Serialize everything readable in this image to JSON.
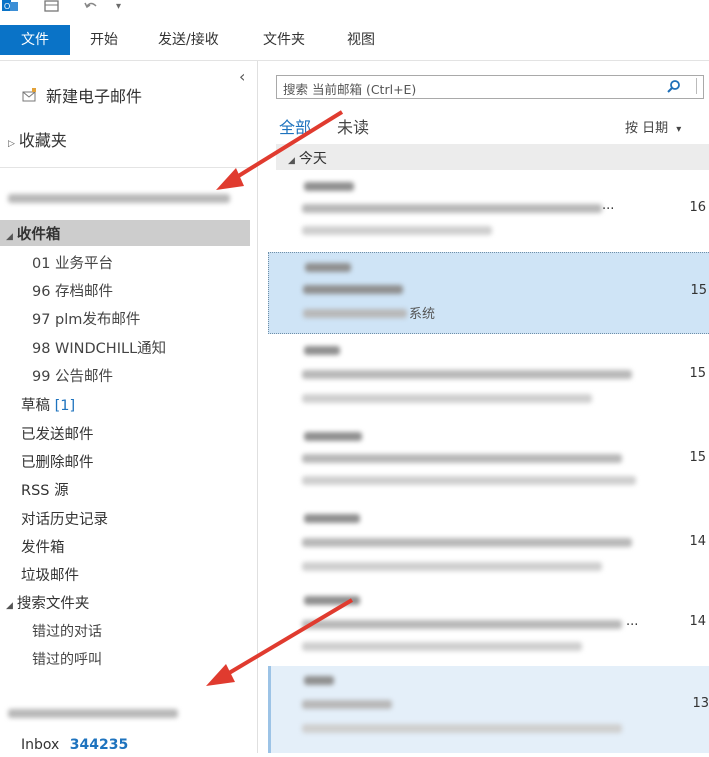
{
  "ribbon": {
    "tabs": [
      {
        "label": "文件",
        "active": true
      },
      {
        "label": "开始"
      },
      {
        "label": "发送/接收"
      },
      {
        "label": "文件夹"
      },
      {
        "label": "视图"
      }
    ]
  },
  "nav": {
    "new_email": "新建电子邮件",
    "favorites": "收藏夹",
    "collapse_glyph": "‹",
    "inbox": "收件箱",
    "inbox_subfolders": [
      "01 业务平台",
      "96 存档邮件",
      "97 plm发布邮件",
      "98 WINDCHILL通知",
      "99 公告邮件"
    ],
    "drafts_label": "草稿",
    "drafts_count": "[1]",
    "folders": [
      "已发送邮件",
      "已删除邮件",
      "RSS 源",
      "对话历史记录",
      "发件箱",
      "垃圾邮件"
    ],
    "search_folders": "搜索文件夹",
    "search_subfolders": [
      "错过的对话",
      "错过的呼叫"
    ],
    "second_account_inbox": "Inbox",
    "second_account_inbox_count": "344235"
  },
  "search": {
    "placeholder": "搜索 当前邮箱 (Ctrl+E)"
  },
  "filters": {
    "all": "全部",
    "unread": "未读",
    "sort": "按 日期",
    "sort_arrow": "▾"
  },
  "list": {
    "group_header": "今天",
    "selected_snippet_tail": "系统",
    "truncated_suffix": "...",
    "times": [
      "16",
      "15",
      "15",
      "15",
      "14",
      "14",
      "13"
    ]
  },
  "colors": {
    "accent": "#0a73c7",
    "selected_item": "#cfe4f6",
    "arrow": "#e03b2f"
  }
}
